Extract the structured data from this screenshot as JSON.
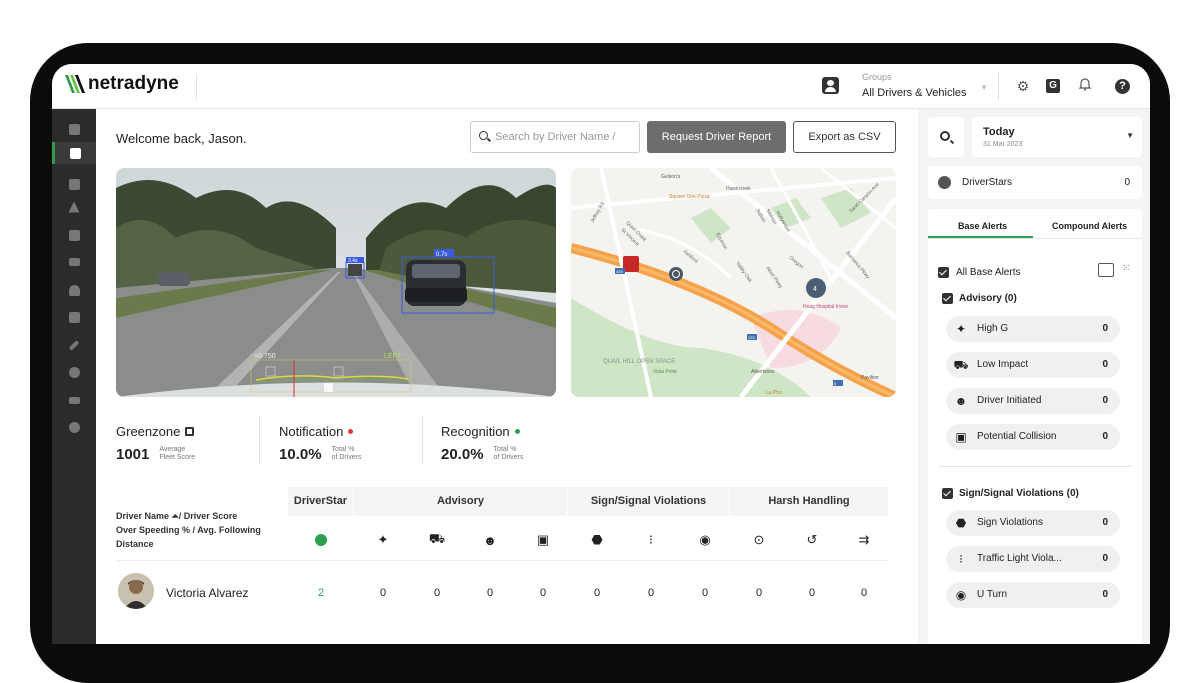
{
  "header": {
    "logo_text": "netradyne",
    "groups_label": "Groups",
    "groups_value": "All Drivers & Vehicles",
    "org_badge": "G"
  },
  "sidebar": {
    "items": [
      "dashboard-icon",
      "report-icon",
      "driver-icon",
      "alert-icon",
      "g-icon",
      "video-icon",
      "user-icon",
      "document-icon",
      "wrench-icon",
      "location-icon",
      "vehicle-icon",
      "settings-icon"
    ],
    "active_index": 1
  },
  "main": {
    "welcome": "Welcome back, Jason.",
    "search_placeholder": "Search by Driver Name /",
    "request_button": "Request Driver Report",
    "export_button": "Export as CSV"
  },
  "video": {
    "left_overlay": "+0.750",
    "right_overlay": "LEFT",
    "box1_label": "3.4s",
    "box2_label": "0.7s"
  },
  "map": {
    "labels": [
      "Gelson's",
      "Square One Pizza",
      "Jeffrey Rd",
      "Quail Creek",
      "St Vincent",
      "Hawkcreek",
      "Sutton",
      "Stetson",
      "Hollywood",
      "Equinox",
      "Ashford",
      "Valley Oak",
      "Alton Pkwy",
      "Oregon",
      "Barranca Pkwy",
      "Sand Canyon Ave",
      "Hoag Hospital Irvine",
      "QUAIL HILL OPEN SPACE",
      "Vista Point",
      "Albertsons",
      "Pavilion",
      "La Pho"
    ],
    "cluster_count": "4",
    "route_badges": [
      "405",
      "133",
      "5"
    ]
  },
  "stats": {
    "greenzone": {
      "label": "Greenzone",
      "value": "1001",
      "sub1": "Average",
      "sub2": "Fleet Score"
    },
    "notification": {
      "label": "Notification",
      "value": "10.0%",
      "sub1": "Total %",
      "sub2": "of Drivers",
      "dot_color": "#e53935"
    },
    "recognition": {
      "label": "Recognition",
      "value": "20.0%",
      "sub1": "Total %",
      "sub2": "of Drivers",
      "dot_color": "#2e9e4f"
    }
  },
  "table": {
    "name_header_l1": "Driver Name ⏶/ Driver Score",
    "name_header_l2": "Over Speeding % / Avg. Following",
    "name_header_l3": "Distance",
    "groups": [
      "DriverStar",
      "Advisory",
      "Sign/Signal Violations",
      "Harsh Handling"
    ],
    "icons": [
      "driverstar-icon",
      "high-g-icon",
      "low-impact-icon",
      "driver-initiated-icon",
      "potential-collision-icon",
      "stop-sign-icon",
      "traffic-light-icon",
      "u-turn-icon",
      "hard-brake-icon",
      "hard-turn-icon",
      "acceleration-icon"
    ],
    "rows": [
      {
        "name": "Victoria Alvarez",
        "values": [
          "2",
          "0",
          "0",
          "0",
          "0",
          "0",
          "0",
          "0",
          "0",
          "0",
          "0"
        ]
      }
    ]
  },
  "right_panel": {
    "date_title": "Today",
    "date_sub": "31 Mar 2023",
    "driverstars_label": "DriverStars",
    "driverstars_value": "0",
    "tab_base": "Base Alerts",
    "tab_compound": "Compound Alerts",
    "all_base": "All Base Alerts",
    "advisory_header": "Advisory (0)",
    "advisory_items": [
      {
        "label": "High G",
        "value": "0",
        "icon": "high-g-icon"
      },
      {
        "label": "Low Impact",
        "value": "0",
        "icon": "low-impact-icon"
      },
      {
        "label": "Driver Initiated",
        "value": "0",
        "icon": "driver-initiated-icon"
      },
      {
        "label": "Potential Collision",
        "value": "0",
        "icon": "potential-collision-icon"
      }
    ],
    "signal_header": "Sign/Signal Violations (0)",
    "signal_items": [
      {
        "label": "Sign Violations",
        "value": "0",
        "icon": "stop-sign-icon"
      },
      {
        "label": "Traffic Light Viola...",
        "value": "0",
        "icon": "traffic-light-icon"
      },
      {
        "label": "U Turn",
        "value": "0",
        "icon": "u-turn-icon"
      }
    ]
  },
  "colors": {
    "accent_green": "#2e9e4f",
    "sidebar_bg": "#2b2b2b",
    "button_dark": "#6d6d6d"
  }
}
